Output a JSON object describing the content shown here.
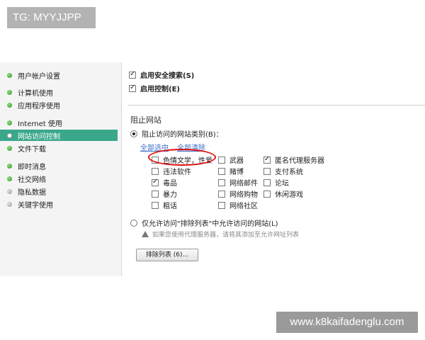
{
  "watermarks": {
    "top": "TG: MYYJJPP",
    "bottom": "www.k8kaifadenglu.com"
  },
  "sidebar": {
    "items": [
      {
        "label": "用户帐户设置",
        "dot": "green"
      },
      {
        "label": "计算机使用",
        "dot": "green"
      },
      {
        "label": "应用程序使用",
        "dot": "green"
      },
      {
        "label": "Internet 使用",
        "dot": "green"
      },
      {
        "label": "网站访问控制",
        "dot": "white",
        "active": true
      },
      {
        "label": "文件下载",
        "dot": "green"
      },
      {
        "label": "即时消息",
        "dot": "green"
      },
      {
        "label": "社交网络",
        "dot": "green"
      },
      {
        "label": "隐私数据",
        "dot": "grey"
      },
      {
        "label": "关键字使用",
        "dot": "grey"
      }
    ]
  },
  "main": {
    "safe_search": {
      "label": "启用安全搜索(S)",
      "checked": true
    },
    "enable_control": {
      "label": "启用控制(E)",
      "checked": true
    },
    "block_heading": "阻止网站",
    "radio_block_categories": {
      "label": "阻止访问的网站类别(B)：",
      "checked": true
    },
    "select_all": "全部选中",
    "clear_all": "全部清除",
    "categories": {
      "col1": [
        {
          "label": "色情文学，性爱",
          "checked": false
        },
        {
          "label": "违法软件",
          "checked": false
        },
        {
          "label": "毒品",
          "checked": true
        },
        {
          "label": "暴力",
          "checked": false
        },
        {
          "label": "粗话",
          "checked": false
        }
      ],
      "col2": [
        {
          "label": "武器",
          "checked": false
        },
        {
          "label": "赌博",
          "checked": false
        },
        {
          "label": "网络邮件",
          "checked": false
        },
        {
          "label": "网络购物",
          "checked": false
        },
        {
          "label": "网络社区",
          "checked": false
        }
      ],
      "col3": [
        {
          "label": "匿名代理服务器",
          "checked": true
        },
        {
          "label": "支付系统",
          "checked": false
        },
        {
          "label": "论坛",
          "checked": false
        },
        {
          "label": "休闲游戏",
          "checked": false
        }
      ]
    },
    "radio_allow_only": {
      "label": "仅允许访问\"排除列表\"中允许访问的网站(L)",
      "checked": false
    },
    "proxy_warning": "如果您使用代理服务器，请将其添加至允许网址列表",
    "exclusion_button": "排除列表 (6)..."
  }
}
